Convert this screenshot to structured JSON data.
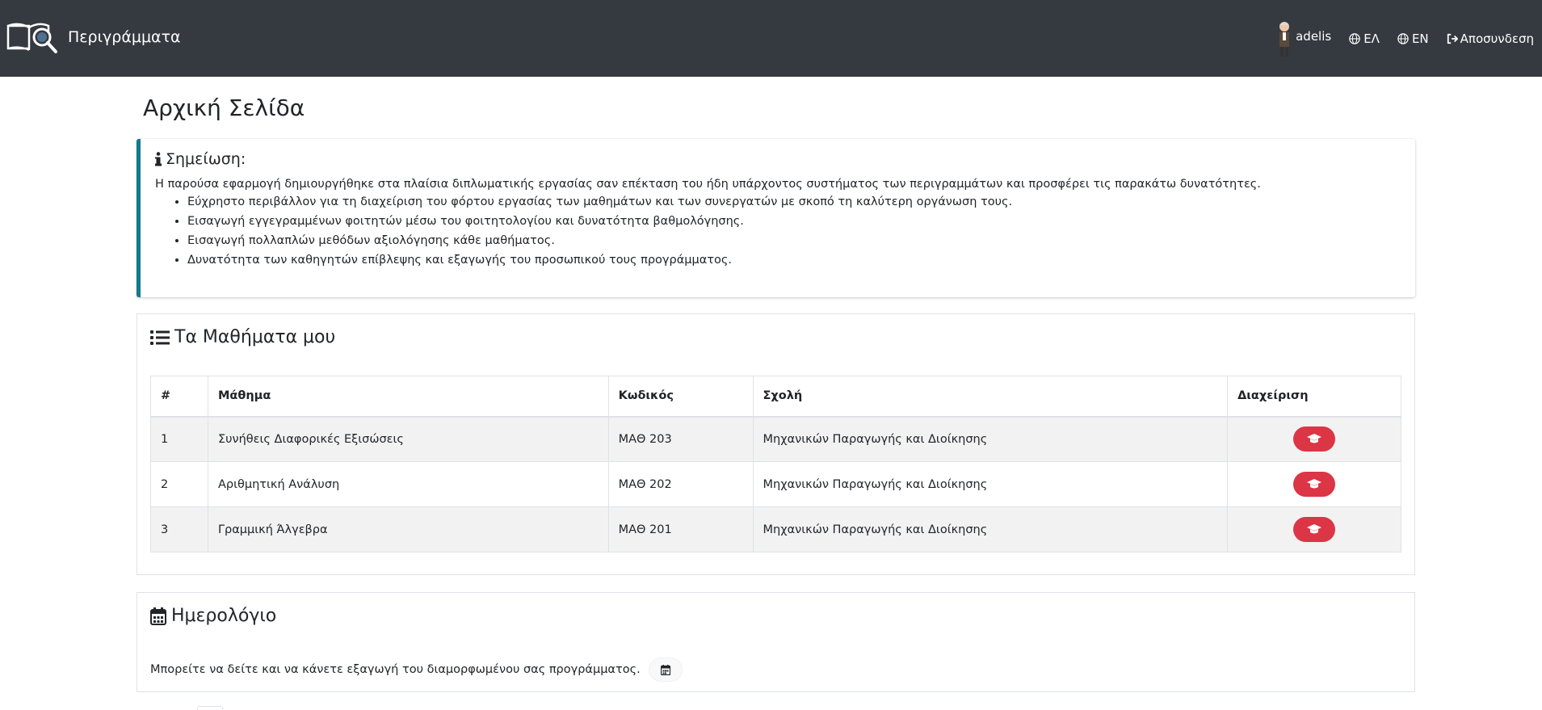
{
  "navbar": {
    "brand": "Περιγράμματα",
    "user": "adelis",
    "lang_el": "ΕΛ",
    "lang_en": "EN",
    "logout": "Αποσυνδεση",
    "bg_color": "#343a40"
  },
  "page": {
    "title": "Αρχική Σελίδα"
  },
  "note": {
    "title": "Σημείωση:",
    "intro": "Η παρούσα εφαρμογή δημιουργήθηκε στα πλαίσια διπλωματικής εργασίας σαν επέκταση του ήδη υπάρχοντος συστήματος των περιγραμμάτων και προσφέρει τις παρακάτω δυνατότητες.",
    "items": [
      "Εύχρηστο περιβάλλον για τη διαχείριση του φόρτου εργασίας των μαθημάτων και των συνεργατών με σκοπό τη καλύτερη οργάνωση τους.",
      "Εισαγωγή εγγεγραμμένων φοιτητών μέσω του φοιτητολογίου και δυνατότητα βαθμολόγησης.",
      "Εισαγωγή πολλαπλών μεθόδων αξιολόγησης κάθε μαθήματος.",
      "Δυνατότητα των καθηγητών επίβλεψης και εξαγωγής του προσωπικού τους προγράμματος."
    ],
    "accent_color": "#117a8b"
  },
  "courses": {
    "title": "Τα Μαθήματα μου",
    "headers": [
      "#",
      "Μάθημα",
      "Κωδικός",
      "Σχολή",
      "Διαχείριση"
    ],
    "rows": [
      {
        "num": "1",
        "name": "Συνήθεις Διαφορικές Εξισώσεις",
        "code": "ΜΑΘ 203",
        "school": "Μηχανικών Παραγωγής και Διοίκησης"
      },
      {
        "num": "2",
        "name": "Αριθμητική Ανάλυση",
        "code": "ΜΑΘ 202",
        "school": "Μηχανικών Παραγωγής και Διοίκησης"
      },
      {
        "num": "3",
        "name": "Γραμμική Άλγεβρα",
        "code": "ΜΑΘ 201",
        "school": "Μηχανικών Παραγωγής και Διοίκησης"
      }
    ],
    "manage_icon": "graduation-cap-icon",
    "button_color": "#dc3545"
  },
  "calendar": {
    "title": "Ημερολόγιο",
    "text": "Μπορείτε να δείτε και να κάνετε εξαγωγή του διαμορφωμένου σας προγράμματος.",
    "icon": "calendar-icon"
  }
}
